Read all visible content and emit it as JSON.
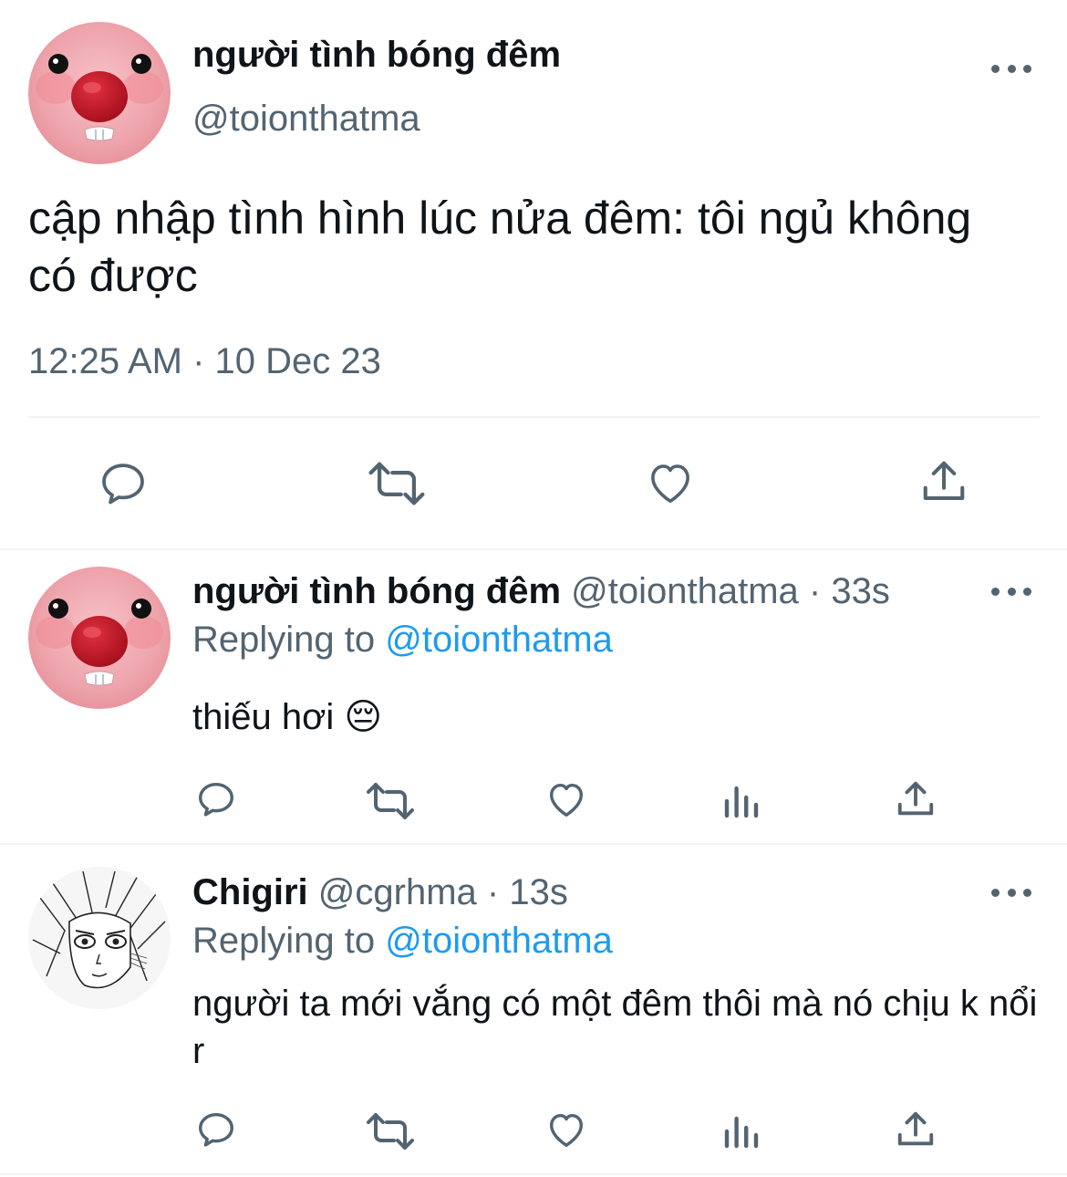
{
  "main_tweet": {
    "display_name": "người tình bóng đêm",
    "handle": "@toionthatma",
    "text": "cập nhập tình hình lúc nửa đêm: tôi ngủ không có được",
    "timestamp": "12:25 AM · 10 Dec 23",
    "icons": [
      "reply-icon",
      "retweet-icon",
      "like-icon",
      "share-icon",
      "more-icon"
    ]
  },
  "replies": [
    {
      "display_name": "người tình bóng đêm",
      "handle": "@toionthatma",
      "dot": "·",
      "age": "33s",
      "replying_prefix": "Replying to",
      "replying_handle": "@toionthatma",
      "text": "thiếu hơi 😔"
    },
    {
      "display_name": "Chigiri",
      "handle": "@cgrhma",
      "dot": "·",
      "age": "13s",
      "replying_prefix": "Replying to",
      "replying_handle": "@toionthatma",
      "text": "người ta mới vắng có một đêm thôi mà nó chịu k nổi r"
    }
  ],
  "colors": {
    "text": "#0f1419",
    "secondary": "#536471",
    "link": "#1d9bf0",
    "divider": "#eff3f4"
  }
}
